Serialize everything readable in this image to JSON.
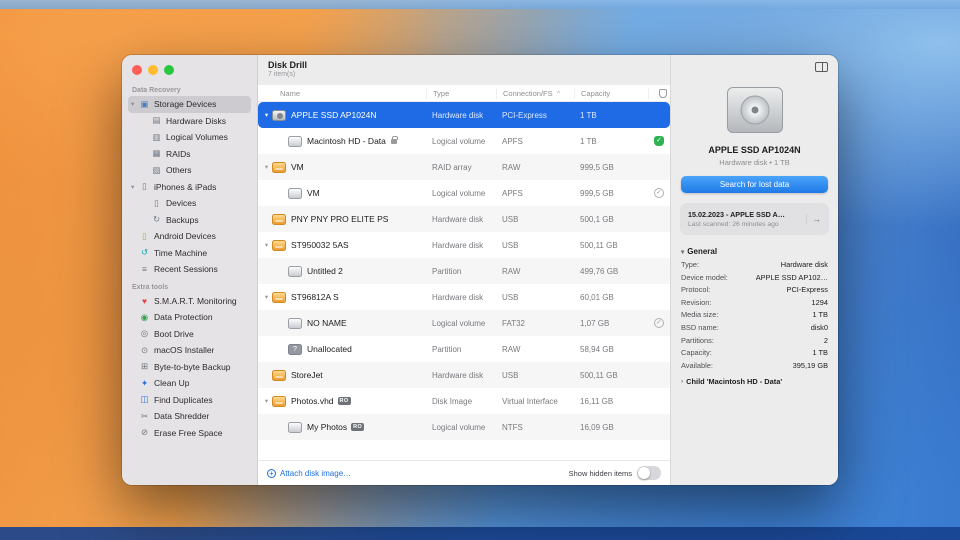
{
  "window": {
    "title": "Disk Drill",
    "items_count": "7 item(s)"
  },
  "colors": {
    "accent": "#1e6be5",
    "button_blue": "#2f8df5",
    "shield_green": "#2eb150",
    "selected_row": "#1e6be5"
  },
  "icon_glyphs": {
    "storage": "▣",
    "hardware": "▤",
    "volumes": "▥",
    "raid": "▦",
    "others": "▧",
    "iphones": "▯",
    "devices": "▯",
    "backups": "↻",
    "android": "▯",
    "time": "↺",
    "sessions": "≡",
    "smart": "♥",
    "protection": "◉",
    "boot": "◎",
    "installer": "⊙",
    "byte": "⊞",
    "clean": "✦",
    "duplicates": "◫",
    "shredder": "✂",
    "erase": "⊘"
  },
  "sidebar": {
    "sections": [
      {
        "header": "Data Recovery",
        "items": [
          {
            "label": "Storage Devices",
            "icon": "storage",
            "color": "#4a7dbf",
            "chevron": true,
            "selected": true,
            "indent": 0
          },
          {
            "label": "Hardware Disks",
            "icon": "hardware",
            "indent": 1
          },
          {
            "label": "Logical Volumes",
            "icon": "volumes",
            "indent": 1
          },
          {
            "label": "RAIDs",
            "icon": "raid",
            "indent": 1
          },
          {
            "label": "Others",
            "icon": "others",
            "indent": 1
          },
          {
            "label": "iPhones & iPads",
            "icon": "iphones",
            "chevron": true,
            "indent": 0
          },
          {
            "label": "Devices",
            "icon": "devices",
            "indent": 1
          },
          {
            "label": "Backups",
            "icon": "backups",
            "indent": 1
          },
          {
            "label": "Android Devices",
            "icon": "android",
            "color": "#7bc043",
            "indent": 0
          },
          {
            "label": "Time Machine",
            "icon": "time",
            "color": "#12a5b5",
            "indent": 0
          },
          {
            "label": "Recent Sessions",
            "icon": "sessions",
            "indent": 0
          }
        ]
      },
      {
        "header": "Extra tools",
        "items": [
          {
            "label": "S.M.A.R.T. Monitoring",
            "icon": "smart",
            "color": "#e5484d",
            "indent": 0
          },
          {
            "label": "Data Protection",
            "icon": "protection",
            "color": "#30a14e",
            "indent": 0
          },
          {
            "label": "Boot Drive",
            "icon": "boot",
            "indent": 0
          },
          {
            "label": "macOS Installer",
            "icon": "installer",
            "indent": 0
          },
          {
            "label": "Byte-to-byte Backup",
            "icon": "byte",
            "indent": 0
          },
          {
            "label": "Clean Up",
            "icon": "clean",
            "color": "#1f6fe0",
            "indent": 0
          },
          {
            "label": "Find Duplicates",
            "icon": "duplicates",
            "color": "#1f6fe0",
            "indent": 0
          },
          {
            "label": "Data Shredder",
            "icon": "shredder",
            "indent": 0
          },
          {
            "label": "Erase Free Space",
            "icon": "erase",
            "indent": 0
          }
        ]
      }
    ]
  },
  "table": {
    "columns": [
      {
        "label": "Name"
      },
      {
        "label": "Type"
      },
      {
        "label": "Connection/FS"
      },
      {
        "label": "Capacity"
      }
    ],
    "sort_indicator": "^",
    "rows": [
      {
        "name": "APPLE SSD AP1024N",
        "type": "Hardware disk",
        "conn": "PCI-Express",
        "cap": "1 TB",
        "indent": 0,
        "chevron": true,
        "icon": "disk-internal",
        "selected": true
      },
      {
        "name": "Macintosh HD - Data",
        "type": "Logical volume",
        "conn": "APFS",
        "cap": "1 TB",
        "indent": 1,
        "icon": "volume",
        "lock": true,
        "status": "shield-green"
      },
      {
        "name": "VM",
        "type": "RAID array",
        "conn": "RAW",
        "cap": "999,5 GB",
        "indent": 0,
        "chevron": true,
        "icon": "drive"
      },
      {
        "name": "VM",
        "type": "Logical volume",
        "conn": "APFS",
        "cap": "999,5 GB",
        "indent": 1,
        "icon": "volume",
        "status": "check"
      },
      {
        "name": "PNY PNY PRO ELITE PS",
        "type": "Hardware disk",
        "conn": "USB",
        "cap": "500,1 GB",
        "indent": 0,
        "icon": "drive"
      },
      {
        "name": "ST950032 5AS",
        "type": "Hardware disk",
        "conn": "USB",
        "cap": "500,11 GB",
        "indent": 0,
        "chevron": true,
        "icon": "drive"
      },
      {
        "name": "Untitled 2",
        "type": "Partition",
        "conn": "RAW",
        "cap": "499,76 GB",
        "indent": 1,
        "icon": "volume"
      },
      {
        "name": "ST96812A S",
        "type": "Hardware disk",
        "conn": "USB",
        "cap": "60,01 GB",
        "indent": 0,
        "chevron": true,
        "icon": "drive"
      },
      {
        "name": "NO NAME",
        "type": "Logical volume",
        "conn": "FAT32",
        "cap": "1,07 GB",
        "indent": 1,
        "icon": "volume",
        "status": "check"
      },
      {
        "name": "Unallocated",
        "type": "Partition",
        "conn": "RAW",
        "cap": "58,94 GB",
        "indent": 1,
        "icon": "unknown"
      },
      {
        "name": "StoreJet",
        "type": "Hardware disk",
        "conn": "USB",
        "cap": "500,11 GB",
        "indent": 0,
        "icon": "drive"
      },
      {
        "name": "Photos.vhd",
        "type": "Disk Image",
        "conn": "Virtual Interface",
        "cap": "16,11 GB",
        "indent": 0,
        "chevron": true,
        "icon": "drive",
        "badge": "RO"
      },
      {
        "name": "My Photos",
        "type": "Logical volume",
        "conn": "NTFS",
        "cap": "16,09 GB",
        "indent": 1,
        "icon": "volume",
        "badge": "RO"
      }
    ]
  },
  "footer": {
    "attach_label": "Attach disk image…",
    "show_hidden_label": "Show hidden items"
  },
  "details": {
    "device_title": "APPLE SSD AP1024N",
    "device_subtitle": "Hardware disk • 1 TB",
    "search_button": "Search for lost data",
    "scan_card": {
      "title": "15.02.2023 - APPLE SSD A…",
      "subtitle": "Last scanned: 26 minutes ago",
      "arrow": "→"
    },
    "general_header": "General",
    "general_rows": [
      {
        "label": "Type:",
        "value": "Hardware disk"
      },
      {
        "label": "Device model:",
        "value": "APPLE SSD AP102…"
      },
      {
        "label": "Protocol:",
        "value": "PCI-Express"
      },
      {
        "label": "Revision:",
        "value": "1294"
      },
      {
        "label": "Media size:",
        "value": "1 TB"
      },
      {
        "label": "BSD name:",
        "value": "disk0"
      },
      {
        "label": "Partitions:",
        "value": "2"
      },
      {
        "label": "Capacity:",
        "value": "1 TB"
      },
      {
        "label": "Available:",
        "value": "395,19 GB"
      }
    ],
    "child_row": "Child 'Macintosh HD - Data'"
  }
}
